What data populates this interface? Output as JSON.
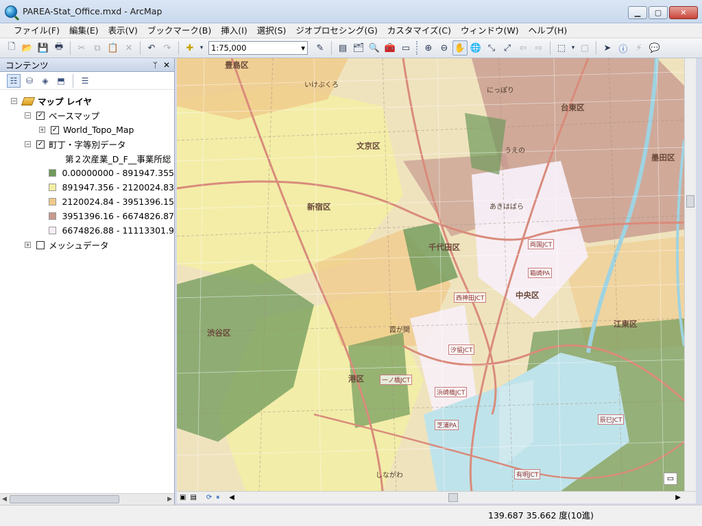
{
  "window": {
    "title": "PAREA-Stat_Office.mxd - ArcMap",
    "minimize_glyph": "▁",
    "maximize_glyph": "▢",
    "close_glyph": "✕"
  },
  "menu": {
    "items": [
      "ファイル(F)",
      "編集(E)",
      "表示(V)",
      "ブックマーク(B)",
      "挿入(I)",
      "選択(S)",
      "ジオプロセシング(G)",
      "カスタマイズ(C)",
      "ウィンドウ(W)",
      "ヘルプ(H)"
    ]
  },
  "toolbar": {
    "scale": "1:75,000",
    "scale_dropdown_glyph": "▾"
  },
  "contents": {
    "title": "コンテンツ",
    "pin_glyph": "ᛘ",
    "close_glyph": "✕",
    "data_frame": "マップ レイヤ",
    "basemap_group": "ベースマップ",
    "basemap_layer": "World_Topo_Map",
    "data_layer": "町丁・字等別データ",
    "field_heading": "第２次産業_D_F__事業所総",
    "legend": [
      {
        "label": "0.00000000 - 891947.355",
        "color": "#6f9a5b"
      },
      {
        "label": "891947.356 - 2120024.83",
        "color": "#f3efa4"
      },
      {
        "label": "2120024.84 - 3951396.15",
        "color": "#f0c98a"
      },
      {
        "label": "3951396.16 - 6674826.87",
        "color": "#c89a90"
      },
      {
        "label": "6674826.88 - 11113301.9",
        "color": "#f7eef7"
      }
    ],
    "mesh_layer": "メッシュデータ"
  },
  "map": {
    "labels": {
      "toshima": "豊島区",
      "bunkyo": "文京区",
      "taito": "台東区",
      "sumida": "墨田区",
      "shinjuku": "新宿区",
      "chiyoda": "千代田区",
      "chuo": "中央区",
      "minato": "港区",
      "shibuya": "渋谷区",
      "koto": "江東区",
      "akihabara": "あきはばら",
      "ikebukuro": "いけぶくろ",
      "nippori": "にっぽり",
      "ueno": "うえの",
      "shinagawa": "しながわ",
      "ryogoku": "両国JCT",
      "hakozaki": "箱崎PA",
      "nishikanda": "西神田JCT",
      "shiodome": "汐留JCT",
      "ichinohashi": "一ノ橋JCT",
      "hamazakibashi": "浜崎橋JCT",
      "shibaura": "芝浦PA",
      "ariake": "有明JCT",
      "tatsumi": "辰巳JCT",
      "kasumigaseki": "霞が関"
    }
  },
  "status": {
    "coordinates": "139.687  35.662 度(10進)"
  }
}
